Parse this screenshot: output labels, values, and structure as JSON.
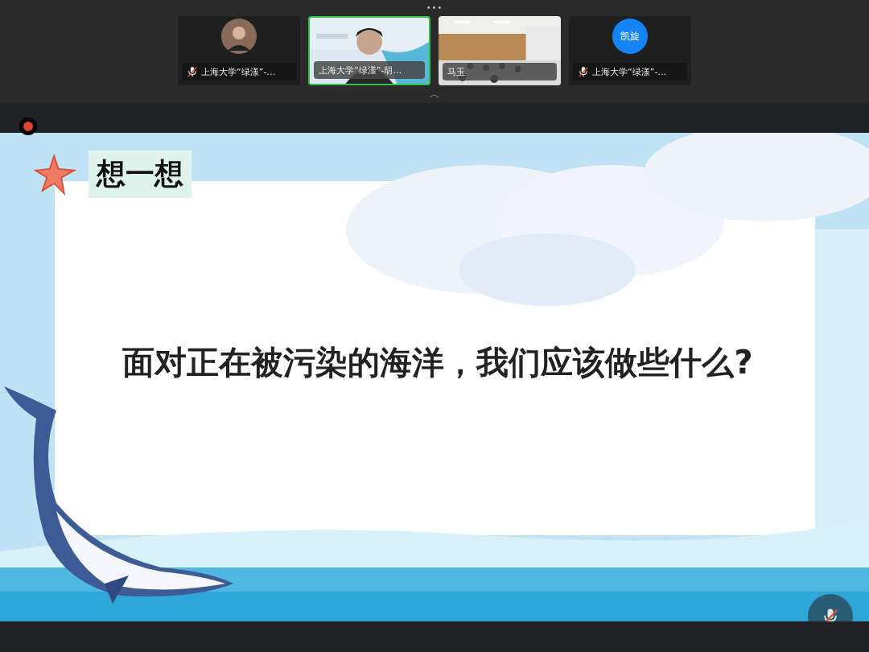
{
  "meeting": {
    "more_dots": "•••",
    "participants": [
      {
        "name": "上海大学“绿漾”-…",
        "muted": true,
        "selected": false
      },
      {
        "kind": "video",
        "name": "上海大学“绿漾”-胡…",
        "muted": false,
        "selected": true
      },
      {
        "kind": "room",
        "name": "马玉",
        "muted": false,
        "selected": false
      },
      {
        "kind": "initials",
        "initials": "凯旋",
        "name": "上海大学“绿漾”-…",
        "muted": true,
        "selected": false
      }
    ],
    "collapse": "︿",
    "recording": true
  },
  "slide": {
    "heading": "想一想",
    "question": "面对正在被污染的海洋，我们应该做些什么?"
  },
  "mic": {
    "muted": true
  }
}
